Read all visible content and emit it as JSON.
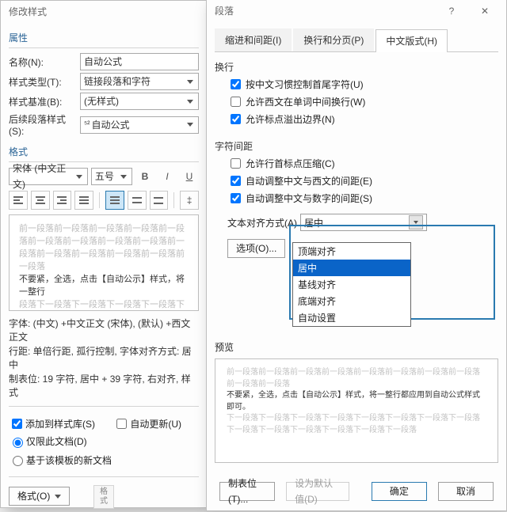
{
  "left": {
    "title": "修改样式",
    "section_props": "属性",
    "name_label": "名称(N):",
    "name_value": "自动公式",
    "style_type_label": "样式类型(T):",
    "style_type_value": "链接段落和字符",
    "style_based_label": "样式基准(B):",
    "style_based_value": "(无样式)",
    "next_style_label": "后续段落样式(S):",
    "next_style_value": "自动公式",
    "section_format": "格式",
    "font_combo": "宋体 (中文正文)",
    "size_combo": "五号",
    "preview_block": "前一段落前一段落前一段落前一段落前一段落前一段落前一段落前一段落前一段落前一段落前一段落前一段落前一段落前一段落前一段落",
    "preview_emph": "不要紧，全选，点击【自动公示】样式，将一整行",
    "preview_after": "段落下一段落下一段落下一段落下一段落下一段落下一段落下一段落下一段落下一段落下一段落下一段落下一段落下一段落下一段落下一段落",
    "notes_line1": "字体: (中文) +中文正文 (宋体), (默认) +西文正文",
    "notes_line2": "行距: 单倍行距, 孤行控制, 字体对齐方式: 居中",
    "notes_line3": "制表位: 19 字符, 居中 +  39 字符, 右对齐, 样式",
    "add_label": "添加到样式库(S)",
    "auto_update_label": "自动更新(U)",
    "only_doc_label": "仅限此文档(D)",
    "tmpl_label": "基于该模板的新文档",
    "format_btn": "格式(O)"
  },
  "right": {
    "title": "段落",
    "tabs": [
      "缩进和间距(I)",
      "换行和分页(P)",
      "中文版式(H)"
    ],
    "active_tab": 2,
    "group1": "换行",
    "cb1": {
      "label": "按中文习惯控制首尾字符(U)",
      "checked": true
    },
    "cb2": {
      "label": "允许西文在单词中间换行(W)",
      "checked": false
    },
    "cb3": {
      "label": "允许标点溢出边界(N)",
      "checked": true
    },
    "group2": "字符间距",
    "cb4": {
      "label": "允许行首标点压缩(C)",
      "checked": false
    },
    "cb5": {
      "label": "自动调整中文与西文的间距(E)",
      "checked": true
    },
    "cb6": {
      "label": "自动调整中文与数字的间距(S)",
      "checked": true
    },
    "textalign_label": "文本对齐方式(A)",
    "textalign_value": "居中",
    "dd_options": [
      "顶端对齐",
      "居中",
      "基线对齐",
      "底端对齐",
      "自动设置"
    ],
    "dd_selected": 1,
    "options_btn": "选项(O)...",
    "preview_label": "预览",
    "pv_gray": "前一段落前一段落前一段落前一段落前一段落前一段落前一段落前一段落前一段落前一段落",
    "pv_emph": "不要紧，全选，点击【自动公示】样式，将一整行都应用到自动公式样式即可。",
    "pv_after": "下一段落下一段落下一段落下一段落下一段落下一段落下一段落下一段落下一段落下一段落下一段落下一段落下一段落下一段落",
    "footer_tab_btn": "制表位(T)...",
    "footer_default_btn": "设为默认值(D)",
    "ok_btn": "确定",
    "cancel_btn": "取消"
  }
}
